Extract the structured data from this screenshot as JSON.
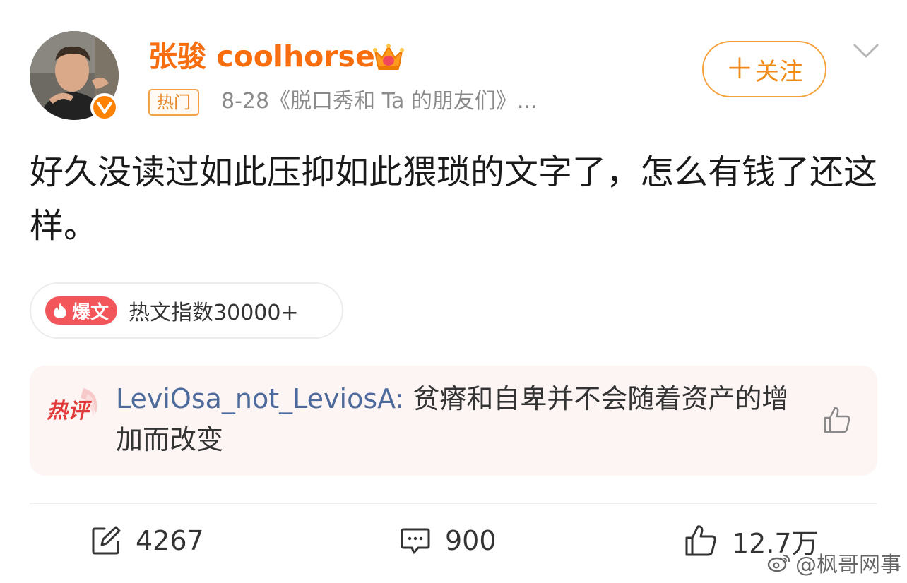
{
  "user": {
    "name": "张骏 coolhorse",
    "hot_tag": "热门",
    "meta": "8-28《脱口秀和 Ta 的朋友们》..."
  },
  "follow_button": {
    "label": "关注"
  },
  "post": {
    "text": "好久没读过如此压抑如此猥琐的文字了，怎么有钱了还这样。"
  },
  "hot_badge": {
    "badge_label": "爆文",
    "index_text": "热文指数30000+"
  },
  "hot_comment": {
    "label": "热评",
    "author": "LeviOsa_not_LeviosA",
    "separator": ": ",
    "text": "贫瘠和自卑并不会随着资产的增加而改变"
  },
  "actions": {
    "repost_count": "4267",
    "comment_count": "900",
    "like_count": "12.7万"
  },
  "watermark": {
    "text": "@枫哥网事"
  },
  "colors": {
    "username": "#f86d0d",
    "accent_orange": "#ff8200",
    "follow_border": "#f5a23c",
    "explode_red": "#f2555a",
    "comment_author": "#4d6a9c",
    "comment_bg": "#fdf4f4"
  },
  "icons": {
    "verified": "verified-v-icon",
    "crown": "crown-icon",
    "chevron": "chevron-down-icon",
    "explode": "flame-icon",
    "comment_like": "thumbs-up-icon",
    "repost": "repost-icon",
    "comment": "comment-icon",
    "like": "thumbs-up-icon",
    "watermark": "weibo-logo-icon"
  }
}
